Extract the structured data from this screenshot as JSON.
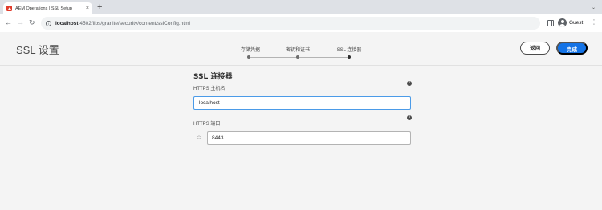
{
  "browser": {
    "tab_title": "AEM Operations | SSL Setup",
    "tab_close": "×",
    "new_tab": "+",
    "url_host": "localhost",
    "url_path": ":4502/libs/granite/security/content/sslConfig.html",
    "profile_label": "Guest"
  },
  "page": {
    "title": "SSL 设置",
    "wizard_steps": [
      {
        "label": "存储凭据",
        "current": false
      },
      {
        "label": "密钥和证书",
        "current": false
      },
      {
        "label": "SSL 连接器",
        "current": true
      }
    ],
    "back_label": "返回",
    "done_label": "完成",
    "accent_color": "#1473e6"
  },
  "form": {
    "section_title": "SSL 连接器",
    "https_hostname": {
      "label": "HTTPS 主机名",
      "value": "localhost"
    },
    "https_port": {
      "label": "HTTPS 端口",
      "value": "8443"
    }
  }
}
